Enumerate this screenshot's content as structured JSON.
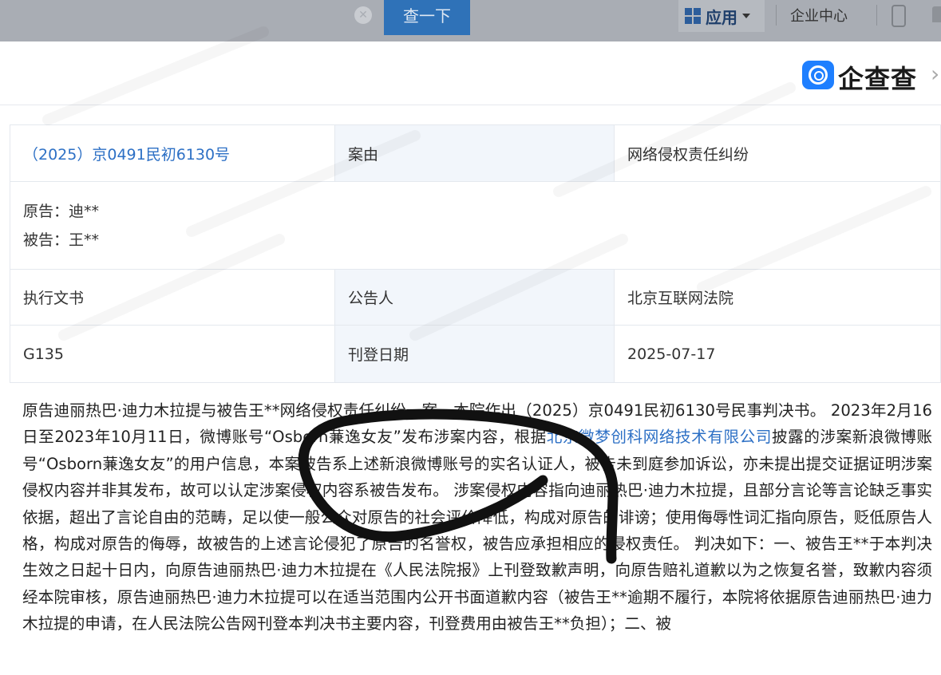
{
  "topbar": {
    "search_button": "查一下",
    "apps_label": "应用",
    "enterprise_center": "企业中心"
  },
  "header": {
    "logo_text": "企查查"
  },
  "colors": {
    "link": "#2d70c5",
    "search_button": "#2f72b8",
    "logo": "#1e7fff",
    "label_bg": "#f2f6fb"
  },
  "case": {
    "case_number": "（2025）京0491民初6130号",
    "cause_label": "案由",
    "cause_value": "网络侵权责任纠纷",
    "plaintiff": "原告：迪**",
    "defendant": "被告：王**",
    "document_type": "执行文书",
    "announcer_label": "公告人",
    "announcer_value": "北京互联网法院",
    "code": "G135",
    "publish_date_label": "刊登日期",
    "publish_date_value": "2025-07-17"
  },
  "body": {
    "p1": "原告迪丽热巴·迪力木拉提与被告王**网络侵权责任纠纷一案，本院作出（2025）京0491民初6130号民事判决书。 2023年2月16日至2023年10月11日，微博账号“Osborn蒹逸女友”发布涉案内容，根据",
    "link": "北京微梦创科网络技术有限公司",
    "p2": "披露的涉案新浪微博账号“Osborn蒹逸女友”的用户信息，本案被告系上述新浪微博账号的实名认证人，被告未到庭参加诉讼，亦未提出提交证据证明涉案侵权内容并非其发布，故可以认定涉案侵权内容系被告发布。 涉案侵权内容指向迪丽热巴·迪力木拉提，且部分言论等言论缺乏事实依据，超出了言论自由的范畴，足以使一般公众对原告的社会评价降低，构成对原告的诽谤；使用侮辱性词汇指向原告，贬低原告人格，构成对原告的侮辱，故被告的上述言论侵犯了原告的名誉权，被告应承担相应的侵权责任。 判决如下：一、被告王**于本判决生效之日起十日内，向原告迪丽热巴·迪力木拉提在《人民法院报》上刊登致歉声明，向原告赔礼道歉以为之恢复名誉，致歉内容须经本院审核，原告迪丽热巴·迪力木拉提可以在适当范围内公开书面道歉内容（被告王**逾期不履行，本院将依据原告迪丽热巴·迪力木拉提的申请，在人民法院公告网刊登本判决书主要内容，刊登费用由被告王**负担）；二、被"
  }
}
